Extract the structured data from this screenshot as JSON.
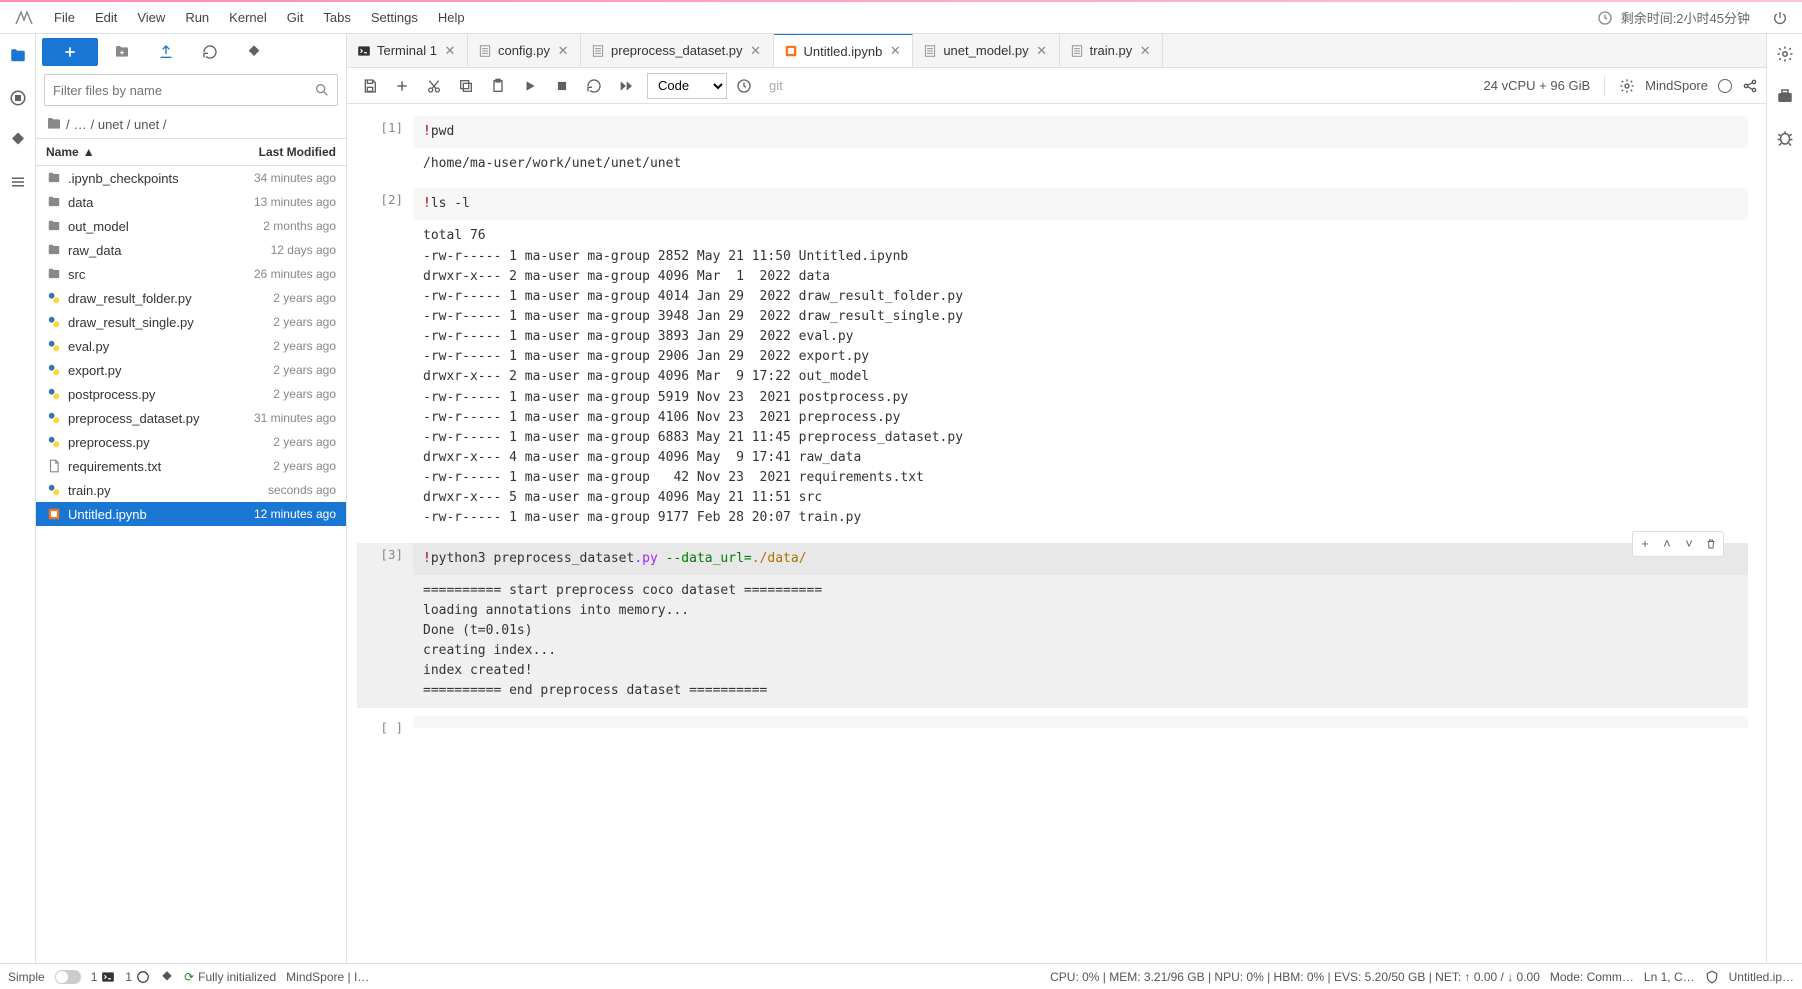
{
  "menu": [
    "File",
    "Edit",
    "View",
    "Run",
    "Kernel",
    "Git",
    "Tabs",
    "Settings",
    "Help"
  ],
  "topbar_right": {
    "countdown": "剩余时间:2小时45分钟"
  },
  "file_browser": {
    "filter_placeholder": "Filter files by name",
    "breadcrumb": [
      "/",
      "…",
      "/ unet / unet /"
    ],
    "headers": {
      "name": "Name",
      "modified": "Last Modified"
    },
    "files": [
      {
        "name": ".ipynb_checkpoints",
        "type": "folder",
        "modified": "34 minutes ago"
      },
      {
        "name": "data",
        "type": "folder",
        "modified": "13 minutes ago"
      },
      {
        "name": "out_model",
        "type": "folder",
        "modified": "2 months ago"
      },
      {
        "name": "raw_data",
        "type": "folder",
        "modified": "12 days ago"
      },
      {
        "name": "src",
        "type": "folder",
        "modified": "26 minutes ago"
      },
      {
        "name": "draw_result_folder.py",
        "type": "py",
        "modified": "2 years ago"
      },
      {
        "name": "draw_result_single.py",
        "type": "py",
        "modified": "2 years ago"
      },
      {
        "name": "eval.py",
        "type": "py",
        "modified": "2 years ago"
      },
      {
        "name": "export.py",
        "type": "py",
        "modified": "2 years ago"
      },
      {
        "name": "postprocess.py",
        "type": "py",
        "modified": "2 years ago"
      },
      {
        "name": "preprocess_dataset.py",
        "type": "py",
        "modified": "31 minutes ago"
      },
      {
        "name": "preprocess.py",
        "type": "py",
        "modified": "2 years ago"
      },
      {
        "name": "requirements.txt",
        "type": "txt",
        "modified": "2 years ago"
      },
      {
        "name": "train.py",
        "type": "py",
        "modified": "seconds ago"
      },
      {
        "name": "Untitled.ipynb",
        "type": "nb",
        "modified": "12 minutes ago",
        "selected": true
      }
    ]
  },
  "tabs": [
    {
      "label": "Terminal 1",
      "icon": "terminal",
      "active": false
    },
    {
      "label": "config.py",
      "icon": "py",
      "active": false
    },
    {
      "label": "preprocess_dataset.py",
      "icon": "py",
      "active": false
    },
    {
      "label": "Untitled.ipynb",
      "icon": "nb",
      "active": true
    },
    {
      "label": "unet_model.py",
      "icon": "py",
      "active": false
    },
    {
      "label": "train.py",
      "icon": "py",
      "active": false
    }
  ],
  "nb_toolbar": {
    "cell_type": "Code",
    "git_label": "git",
    "resources": "24 vCPU + 96 GiB",
    "kernel": "MindSpore"
  },
  "cells": [
    {
      "prompt": "[1]",
      "input_html": "<span class='code-red'>!</span>pwd",
      "output": "/home/ma-user/work/unet/unet/unet"
    },
    {
      "prompt": "[2]",
      "input_html": "<span class='code-red'>!</span>ls -l",
      "output": "total 76\n-rw-r----- 1 ma-user ma-group 2852 May 21 11:50 Untitled.ipynb\ndrwxr-x--- 2 ma-user ma-group 4096 Mar  1  2022 data\n-rw-r----- 1 ma-user ma-group 4014 Jan 29  2022 draw_result_folder.py\n-rw-r----- 1 ma-user ma-group 3948 Jan 29  2022 draw_result_single.py\n-rw-r----- 1 ma-user ma-group 3893 Jan 29  2022 eval.py\n-rw-r----- 1 ma-user ma-group 2906 Jan 29  2022 export.py\ndrwxr-x--- 2 ma-user ma-group 4096 Mar  9 17:22 out_model\n-rw-r----- 1 ma-user ma-group 5919 Nov 23  2021 postprocess.py\n-rw-r----- 1 ma-user ma-group 4106 Nov 23  2021 preprocess.py\n-rw-r----- 1 ma-user ma-group 6883 May 21 11:45 preprocess_dataset.py\ndrwxr-x--- 4 ma-user ma-group 4096 May  9 17:41 raw_data\n-rw-r----- 1 ma-user ma-group   42 Nov 23  2021 requirements.txt\ndrwxr-x--- 5 ma-user ma-group 4096 May 21 11:51 src\n-rw-r----- 1 ma-user ma-group 9177 Feb 28 20:07 train.py"
    },
    {
      "prompt": "[3]",
      "selected": true,
      "input_html": "<span class='code-red'>!</span>python3 preprocess_dataset<span class='code-purple'>.py</span> <span class='code-green'>--data_url=</span><span class='code-orange'>./data/</span>",
      "output": "========== start preprocess coco dataset ==========\nloading annotations into memory...\nDone (t=0.01s)\ncreating index...\nindex created!\n========== end preprocess dataset =========="
    },
    {
      "prompt": "[ ]",
      "input_html": "",
      "output": null
    }
  ],
  "status": {
    "simple": "Simple",
    "term_count": "1",
    "kernel_count": "1",
    "git_status": "Fully initialized",
    "kernel_name": "MindSpore | I…",
    "metrics": "CPU: 0%  |  MEM: 3.21/96 GB  |  NPU: 0%  |  HBM: 0%  |  EVS: 5.20/50 GB  |  NET: ↑ 0.00 / ↓ 0.00",
    "mode": "Mode: Comm…",
    "ln": "Ln 1, C…",
    "file": "Untitled.ip…"
  }
}
